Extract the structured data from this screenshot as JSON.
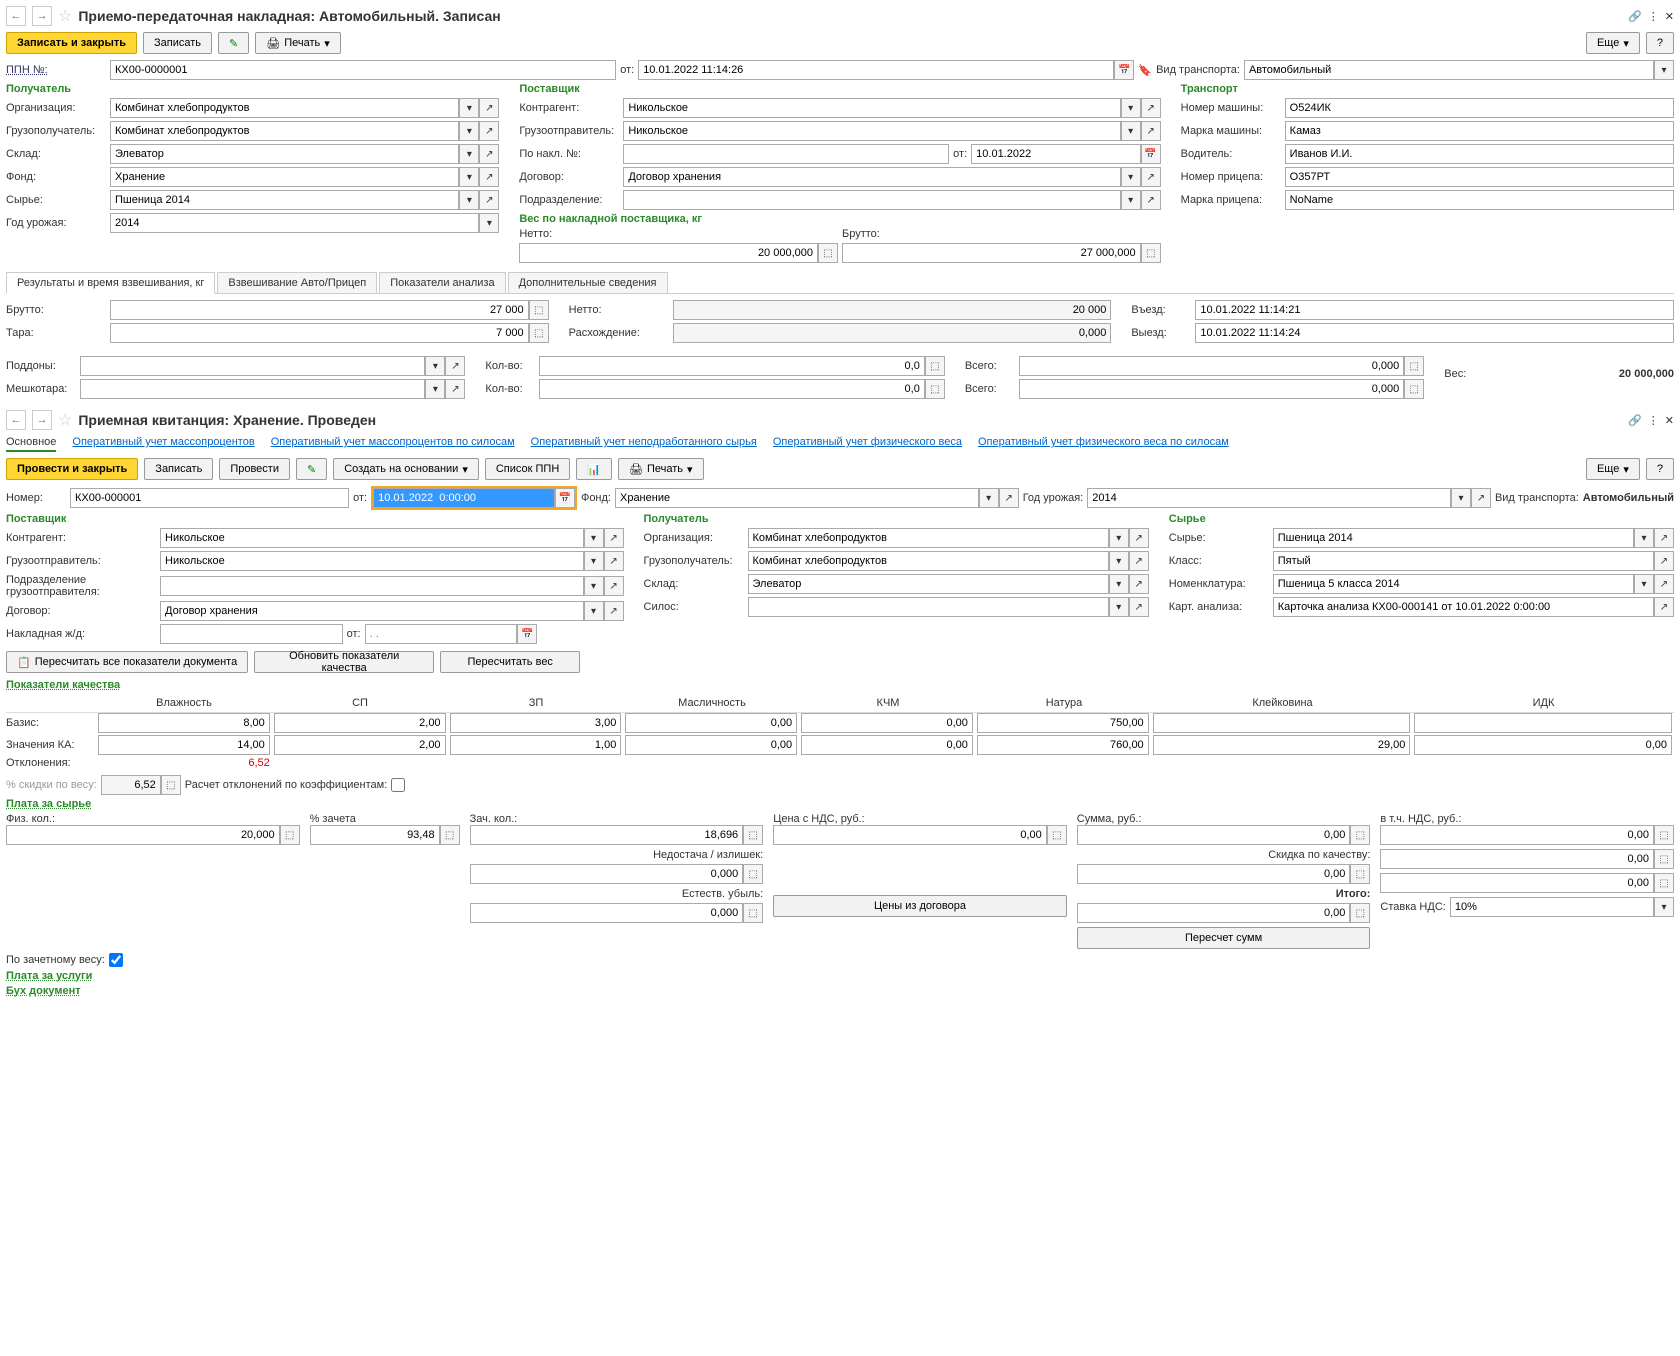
{
  "doc1": {
    "title": "Приемо-передаточная накладная: Автомобильный. Записан",
    "btn_save_close": "Записать и закрыть",
    "btn_save": "Записать",
    "btn_print": "Печать",
    "btn_more": "Еще",
    "ppn_label": "ППН №:",
    "ppn_num": "КХ00-0000001",
    "ot_label": "от:",
    "ot_date": "10.01.2022 11:14:26",
    "transport_type_label": "Вид транспорта:",
    "transport_type": "Автомобильный",
    "sec_recipient": "Получатель",
    "sec_supplier": "Поставщик",
    "sec_transport": "Транспорт",
    "org_label": "Организация:",
    "org": "Комбинат хлебопродуктов",
    "consignee_label": "Грузополучатель:",
    "consignee": "Комбинат хлебопродуктов",
    "warehouse_label": "Склад:",
    "warehouse": "Элеватор",
    "fund_label": "Фонд:",
    "fund": "Хранение",
    "raw_label": "Сырье:",
    "raw": "Пшеница 2014",
    "year_label": "Год урожая:",
    "year": "2014",
    "counterparty_label": "Контрагент:",
    "counterparty": "Никольское",
    "consignor_label": "Грузоотправитель:",
    "consignor": "Никольское",
    "nakl_label": "По накл. №:",
    "nakl_date": "10.01.2022",
    "contract_label": "Договор:",
    "contract": "Договор хранения",
    "dept_label": "Подразделение:",
    "weight_hdr": "Вес по накладной поставщика, кг",
    "netto_label": "Нетто:",
    "netto": "20 000,000",
    "brutto_label": "Брутто:",
    "brutto_sup": "27 000,000",
    "vehicle_num_label": "Номер машины:",
    "vehicle_num": "О524ИК",
    "vehicle_brand_label": "Марка машины:",
    "vehicle_brand": "Камаз",
    "driver_label": "Водитель:",
    "driver": "Иванов И.И.",
    "trailer_num_label": "Номер прицепа:",
    "trailer_num": "О357РТ",
    "trailer_brand_label": "Марка прицепа:",
    "trailer_brand": "NoName",
    "tab1": "Результаты и время взвешивания, кг",
    "tab2": "Взвешивание Авто/Прицеп",
    "tab3": "Показатели анализа",
    "tab4": "Дополнительные сведения",
    "w_brutto_label": "Брутто:",
    "w_brutto": "27 000",
    "w_netto_label": "Нетто:",
    "w_netto": "20 000",
    "w_tara_label": "Тара:",
    "w_tara": "7 000",
    "w_diff_label": "Расхождение:",
    "w_diff": "0,000",
    "entry_label": "Въезд:",
    "entry": "10.01.2022 11:14:21",
    "exit_label": "Выезд:",
    "exit": "10.01.2022 11:14:24",
    "pallets_label": "Поддоны:",
    "bags_label": "Мешкотара:",
    "qty_label": "Кол-во:",
    "qty1": "0,0",
    "qty2": "0,0",
    "total_label": "Всего:",
    "total1": "0,000",
    "total2": "0,000",
    "weight_label": "Вес:",
    "weight_total": "20 000,000"
  },
  "doc2": {
    "title": "Приемная квитанция: Хранение. Проведен",
    "link_main": "Основное",
    "link1": "Оперативный учет массопроцентов",
    "link2": "Оперативный учет массопроцентов по силосам",
    "link3": "Оперативный учет неподработанного сырья",
    "link4": "Оперативный учет физического веса",
    "link5": "Оперативный учет физического веса по силосам",
    "btn_post_close": "Провести и закрыть",
    "btn_save": "Записать",
    "btn_post": "Провести",
    "btn_create_base": "Создать на основании",
    "btn_ppn_list": "Список ППН",
    "btn_print": "Печать",
    "btn_more": "Еще",
    "num_label": "Номер:",
    "num": "КХ00-000001",
    "ot_label": "от:",
    "ot_date": "10.01.2022  0:00:00",
    "fund_label": "Фонд:",
    "fund": "Хранение",
    "year_label": "Год урожая:",
    "year": "2014",
    "transport_label": "Вид транспорта:",
    "transport": "Автомобильный",
    "sec_supplier": "Поставщик",
    "sec_recipient": "Получатель",
    "sec_raw": "Сырье",
    "counterparty_label": "Контрагент:",
    "counterparty": "Никольское",
    "consignor_label": "Грузоотправитель:",
    "consignor": "Никольское",
    "dept_label": "Подразделение грузоотправителя:",
    "contract_label": "Договор:",
    "contract": "Договор хранения",
    "rail_label": "Накладная ж/д:",
    "org_label": "Организация:",
    "org": "Комбинат хлебопродуктов",
    "consignee_label": "Грузополучатель:",
    "consignee": "Комбинат хлебопродуктов",
    "warehouse_label": "Склад:",
    "warehouse": "Элеватор",
    "silo_label": "Силос:",
    "raw_label": "Сырье:",
    "raw": "Пшеница 2014",
    "class_label": "Класс:",
    "class": "Пятый",
    "nomen_label": "Номенклатура:",
    "nomen": "Пшеница 5 класса 2014",
    "card_label": "Карт. анализа:",
    "card": "Карточка анализа КХ00-000141 от 10.01.2022 0:00:00",
    "btn_recalc_all": "Пересчитать все показатели документа",
    "btn_update_quality": "Обновить показатели качества",
    "btn_recalc_weight": "Пересчитать вес",
    "quality_hdr": "Показатели качества",
    "q_humidity": "Влажность",
    "q_sp": "СП",
    "q_zp": "ЗП",
    "q_oil": "Масличность",
    "q_kchm": "КЧМ",
    "q_nature": "Натура",
    "q_gluten": "Клейковина",
    "q_idk": "ИДК",
    "basis_label": "Базис:",
    "ka_label": "Значения КА:",
    "dev_label": "Отклонения:",
    "basis": {
      "humidity": "8,00",
      "sp": "2,00",
      "zp": "3,00",
      "oil": "0,00",
      "kchm": "0,00",
      "nature": "750,00",
      "gluten": "",
      "idk": ""
    },
    "ka": {
      "humidity": "14,00",
      "sp": "2,00",
      "zp": "1,00",
      "oil": "0,00",
      "kchm": "0,00",
      "nature": "760,00",
      "gluten": "29,00",
      "idk": "0,00"
    },
    "dev_humidity": "6,52",
    "discount_label": "% скидки по весу:",
    "discount": "6,52",
    "coef_label": "Расчет отклонений по коэффициентам:",
    "payment_hdr": "Плата за сырье",
    "phys_label": "Физ. кол.:",
    "phys": "20,000",
    "credit_label": "% зачета",
    "credit": "93,48",
    "credit_qty_label": "Зач. кол.:",
    "credit_qty": "18,696",
    "shortage_label": "Недостача / излишек:",
    "shortage": "0,000",
    "natural_label": "Естеств. убыль:",
    "natural": "0,000",
    "price_label": "Цена с НДС, руб.:",
    "price": "0,00",
    "sum_label": "Сумма, руб.:",
    "sum": "0,00",
    "quality_disc_label": "Скидка по качеству:",
    "quality_disc": "0,00",
    "total_label": "Итого:",
    "total": "0,00",
    "vat_label": "в т.ч. НДС, руб.:",
    "vat": "0,00",
    "vat2": "0,00",
    "vat3": "0,00",
    "credit_weight_label": "По зачетному весу:",
    "btn_prices": "Цены из договора",
    "btn_recalc_sums": "Пересчет сумм",
    "vat_rate_label": "Ставка НДС:",
    "vat_rate": "10%",
    "service_hdr": "Плата за услуги",
    "acc_hdr": "Бух документ"
  }
}
